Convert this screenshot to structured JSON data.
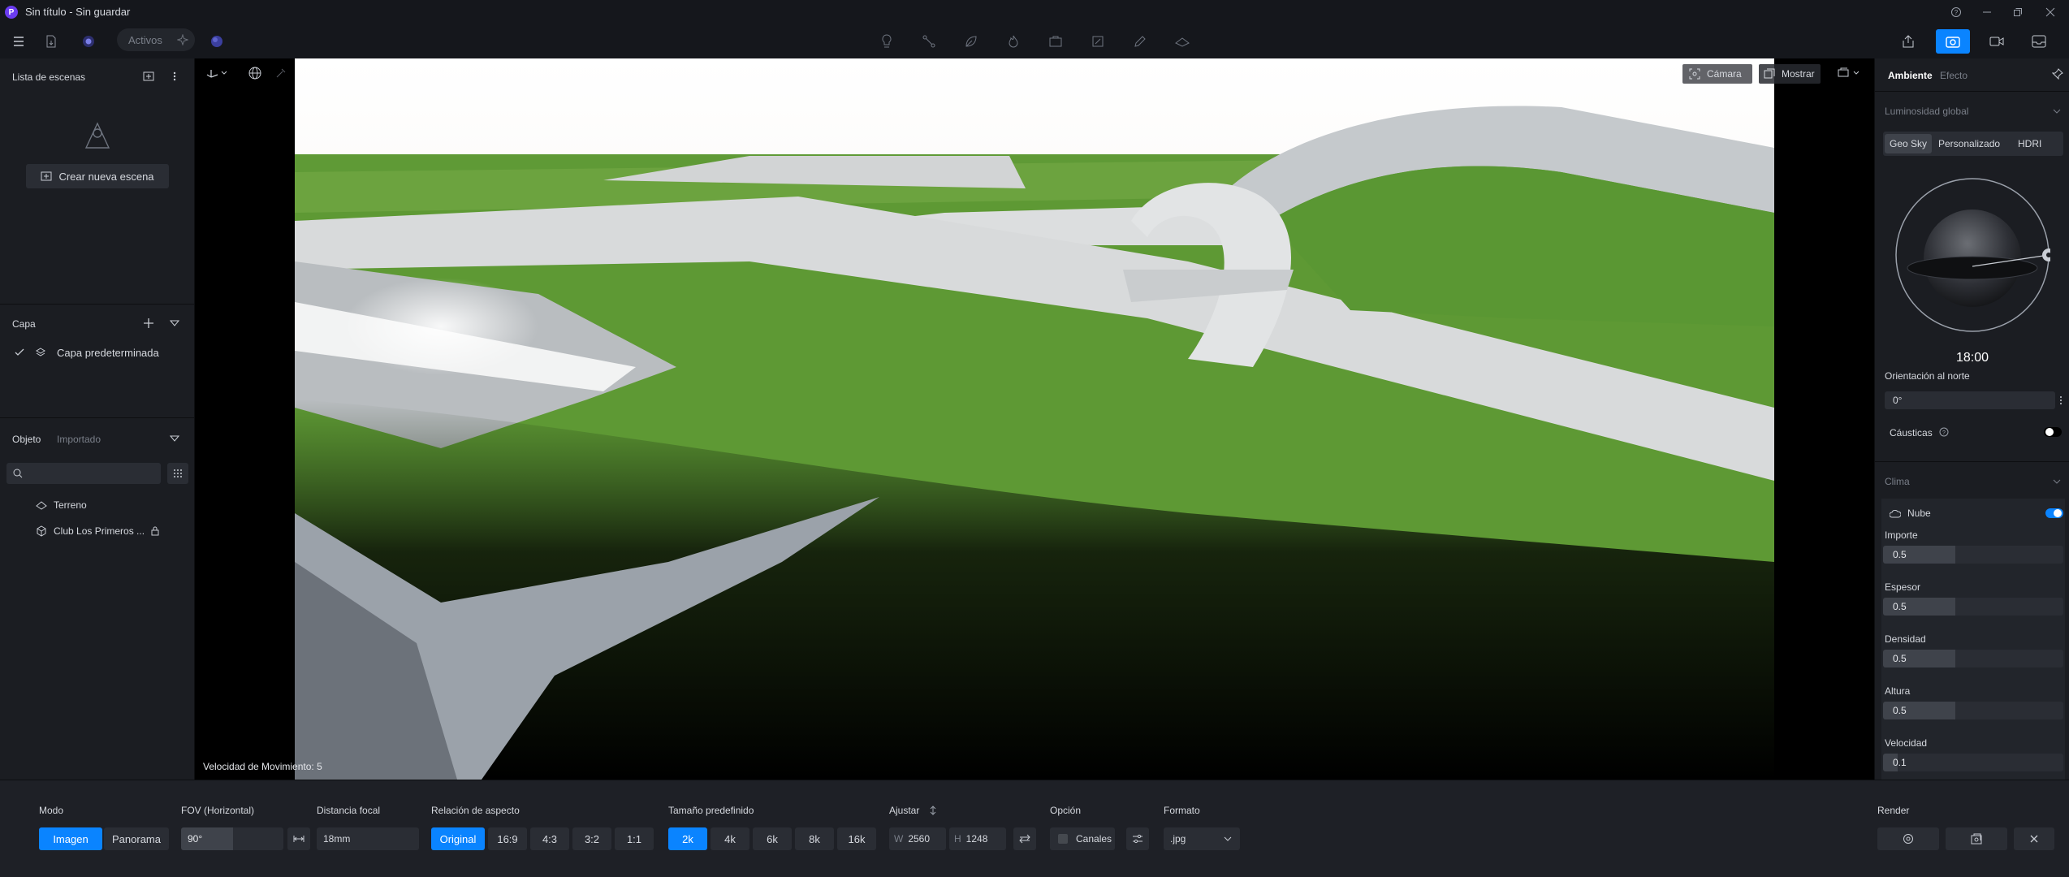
{
  "window": {
    "title": "Sin título - Sin guardar"
  },
  "toolbar": {
    "assets_label": "Activos"
  },
  "left": {
    "scenes_title": "Lista de escenas",
    "create_scene": "Crear nueva escena",
    "layer_title": "Capa",
    "default_layer": "Capa predeterminada",
    "tab_object": "Objeto",
    "tab_imported": "Importado",
    "search_placeholder": "",
    "objects": [
      {
        "label": "Terreno",
        "icon": "terrain-icon"
      },
      {
        "label": "Club Los Primeros ...",
        "icon": "cube-icon"
      }
    ]
  },
  "viewport": {
    "camera_label": "Cámara",
    "show_label": "Mostrar",
    "speed_text": "Velocidad de Movimiento: 5"
  },
  "right": {
    "tab_ambient": "Ambiente",
    "tab_effect": "Efecto",
    "global_light": "Luminosidad global",
    "sky_tabs": [
      "Geo Sky",
      "Personalizado",
      "HDRI"
    ],
    "time": "18:00",
    "north_label": "Orientación al norte",
    "north_value": "0°",
    "caustics_label": "Cáusticas",
    "climate_label": "Clima",
    "cloud_label": "Nube",
    "cloud_enabled": true,
    "params": [
      {
        "label": "Importe",
        "value": "0.5",
        "level": 0.4
      },
      {
        "label": "Espesor",
        "value": "0.5",
        "level": 0.4
      },
      {
        "label": "Densidad",
        "value": "0.5",
        "level": 0.4
      },
      {
        "label": "Altura",
        "value": "0.5",
        "level": 0.4
      },
      {
        "label": "Velocidad",
        "value": "0.1",
        "level": 0.08
      }
    ]
  },
  "bottom": {
    "mode_label": "Modo",
    "mode_image": "Imagen",
    "mode_panorama": "Panorama",
    "fov_label": "FOV (Horizontal)",
    "fov_value": "90°",
    "focal_label": "Distancia focal",
    "focal_value": "18mm",
    "aspect_label": "Relación de aspecto",
    "aspects": [
      "Original",
      "16:9",
      "4:3",
      "3:2",
      "1:1"
    ],
    "size_label": "Tamaño predefinido",
    "sizes": [
      "2k",
      "4k",
      "6k",
      "8k",
      "16k"
    ],
    "adjust_label": "Ajustar",
    "w_label": "W",
    "w_value": "2560",
    "h_label": "H",
    "h_value": "1248",
    "option_label": "Opción",
    "channels_label": "Canales",
    "format_label": "Formato",
    "format_value": ".jpg",
    "render_label": "Render"
  },
  "colors": {
    "accent": "#0a84ff",
    "panel": "#1b1d22",
    "bg": "#15171c",
    "grass": "#5f9a36",
    "concrete": "#c9ccce"
  }
}
